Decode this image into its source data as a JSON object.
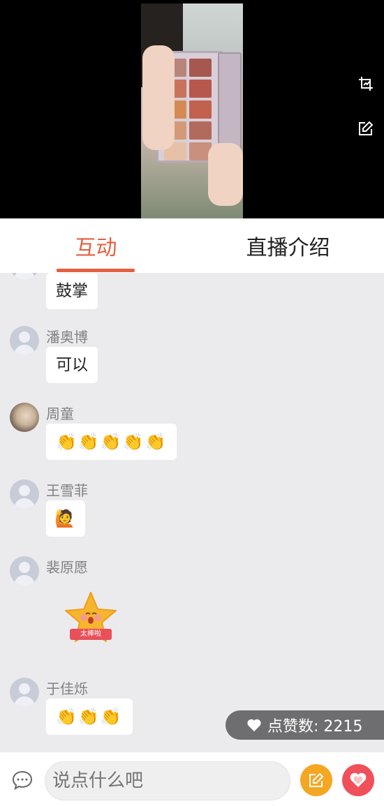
{
  "video": {
    "crop_icon": "crop-icon",
    "edit_icon": "edit-icon"
  },
  "tabs": [
    {
      "label": "互动",
      "active": true
    },
    {
      "label": "直播介绍",
      "active": false
    }
  ],
  "messages": [
    {
      "name": "",
      "text": "鼓掌",
      "avatar": "default"
    },
    {
      "name": "潘奥博",
      "text": "可以",
      "avatar": "default"
    },
    {
      "name": "周童",
      "text": "👏👏👏👏👏",
      "avatar": "photo"
    },
    {
      "name": "王雪菲",
      "text": "🙋",
      "avatar": "default"
    },
    {
      "name": "裴原愿",
      "sticker_text": "太棒啦",
      "avatar": "default"
    },
    {
      "name": "于佳烁",
      "text": "👏👏👏",
      "avatar": "default"
    }
  ],
  "likes": {
    "label": "点赞数: 2215"
  },
  "composer": {
    "placeholder": "说点什么吧"
  },
  "colors": {
    "accent": "#e5603e",
    "edit_button": "#f5a623",
    "heart_button": "#f0505a"
  }
}
